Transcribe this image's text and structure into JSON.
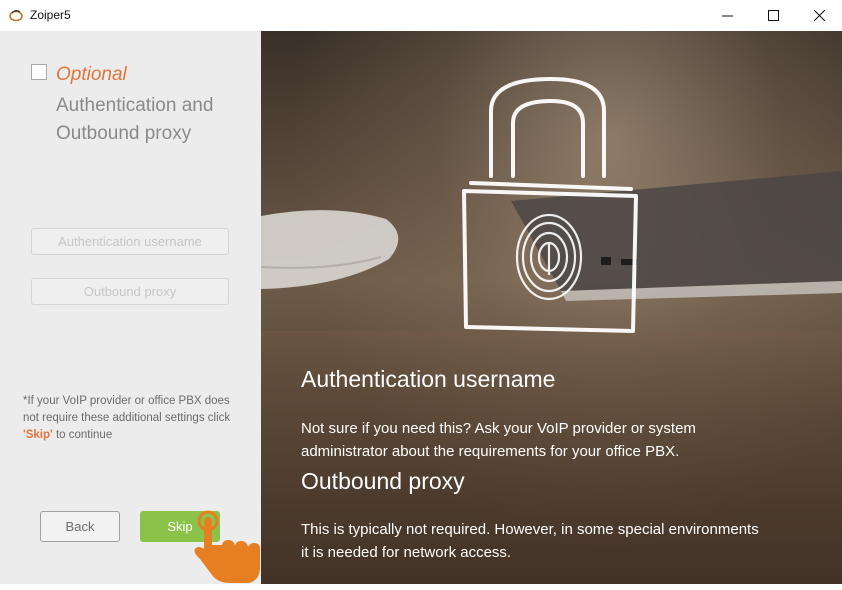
{
  "window": {
    "title": "Zoiper5",
    "controls": {
      "minimize": "minimize-icon",
      "maximize": "maximize-icon",
      "close": "close-icon"
    }
  },
  "left_panel": {
    "optional_label": "Optional",
    "heading": "Authentication and Outbound proxy",
    "checkbox_checked": false,
    "fields": {
      "auth_username": {
        "value": "",
        "placeholder": "Authentication username"
      },
      "outbound_proxy": {
        "value": "",
        "placeholder": "Outbound proxy"
      }
    },
    "note": {
      "before": "*If your VoIP provider or office PBX does not require these additional settings click ",
      "skip_word": "'Skip'",
      "after": " to continue"
    },
    "buttons": {
      "back": "Back",
      "skip": "Skip"
    }
  },
  "right_panel": {
    "sections": [
      {
        "title": "Authentication username",
        "text": " Not sure if you need this? Ask your VoIP provider or system administrator about the requirements for your office PBX."
      },
      {
        "title": "Outbound proxy",
        "text": " This is typically not required. However, in some special environments it is needed for network access."
      }
    ]
  },
  "colors": {
    "accent": "#e0763e",
    "skip_button": "#8bc34a",
    "left_bg": "#ececec"
  }
}
